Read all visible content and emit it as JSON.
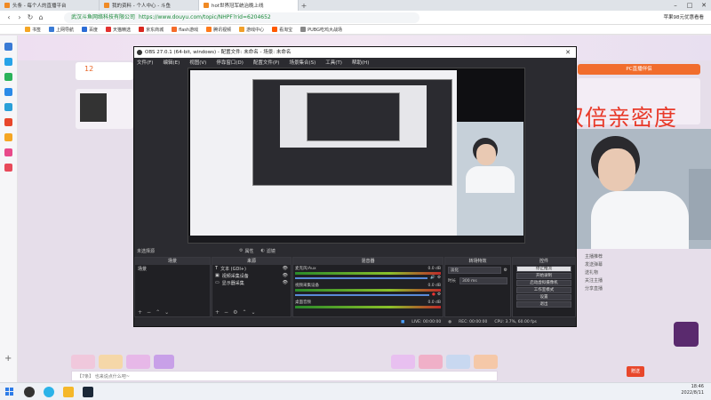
{
  "browser": {
    "tabs": [
      {
        "label": "头条 - 每个人的直播平台",
        "active": false
      },
      {
        "label": "我的资料 - 个人中心 - 斗鱼",
        "active": false
      },
      {
        "label": "hot世界冠军统治晚上线",
        "active": true
      }
    ],
    "new_tab": "+",
    "site_name": "武汉斗鱼网络科技有限公司",
    "url": "https://www.douyu.com/topic/NHPF?rid=6204652",
    "right_text": "苹果98元优惠看看",
    "bookmarks": [
      "书签",
      "上网导航",
      "百度",
      "天猫精选",
      "京东商城",
      "flash游戏",
      "腾讯视频",
      "游戏中心",
      "看淘宝",
      "PUBG吃鸡大战场"
    ]
  },
  "page": {
    "count": "12",
    "right_tag": "PC直播伴侣",
    "overlay_text": "双倍亲密度",
    "chat_placeholder": "【7条】 也来说点什么吧~",
    "bottom_label": "赠送",
    "right_list": [
      "主播推荐",
      "发送弹幕",
      "送礼物",
      "关注主播",
      "分享直播"
    ]
  },
  "obs": {
    "title": "OBS 27.0.1 (64-bit, windows) - 配置文件: 未命名 - 场景: 未命名",
    "menu": [
      "文件(F)",
      "编辑(E)",
      "视图(V)",
      "停靠窗口(D)",
      "配置文件(P)",
      "场景集合(S)",
      "工具(T)",
      "帮助(H)"
    ],
    "status_label": "未选择源",
    "props_label": "属性",
    "filter_label": "滤镜",
    "docks": {
      "scenes": {
        "title": "场景",
        "items": [
          "场景"
        ]
      },
      "sources": {
        "title": "来源",
        "items": [
          "文本 (GDI+)",
          "视频采集设备",
          "显示器采集"
        ]
      },
      "mixer": {
        "title": "混音器",
        "channels": [
          {
            "name": "麦克风/Aux",
            "db": "0.0 dB"
          },
          {
            "name": "视频采集设备",
            "db": "0.0 dB"
          },
          {
            "name": "桌面音频",
            "db": "0.0 dB"
          }
        ]
      },
      "transitions": {
        "title": "转场特效",
        "type": "淡化",
        "duration_label": "时长",
        "duration": "300 ms"
      },
      "controls": {
        "title": "控件",
        "buttons": [
          "停止推流",
          "开始录制",
          "启动虚拟摄像机",
          "工作室模式",
          "设置",
          "退出"
        ]
      }
    },
    "footer": {
      "live": "LIVE: 00:00:00",
      "rec": "REC: 00:00:00",
      "cpu": "CPU: 3.7%, 60.00 fps"
    }
  },
  "taskbar": {
    "time": "18:46",
    "date": "2022/8/11"
  },
  "colors": {
    "accent": "#e83a2a",
    "obs_bg": "#2b2b30",
    "page_bg": "#e6deea"
  }
}
